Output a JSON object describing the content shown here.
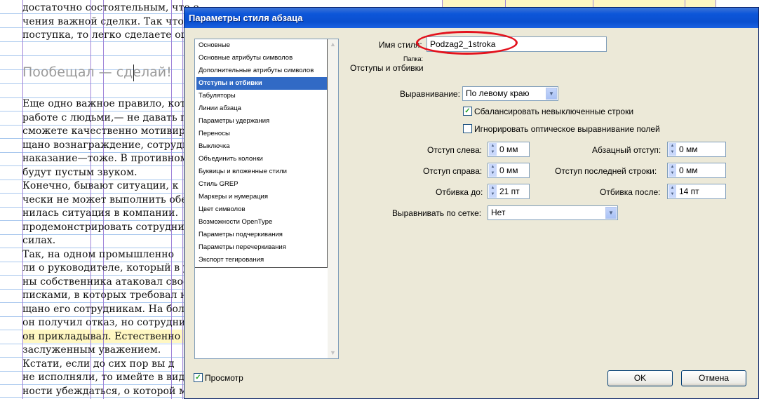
{
  "document": {
    "top_lines": [
      "достаточно состоятельным, что о",
      "чения важной сделки. Так что е",
      "поступка, то легко сделаете ош"
    ],
    "heading": "Пообещал — сделай!",
    "body_lines": [
      "Еще одно важное правило, котор",
      "работе с людьми,— не давать пу",
      "сможете качественно мотивиро",
      "щано вознаграждение, сотрудн",
      "наказание—тоже. В противном",
      "будут пустым звуком.",
      "    Конечно, бывают ситуации, к",
      "чески не может выполнить обе",
      "нилась ситуация в компании.",
      "продемонстрировать сотрудни",
      "силах.",
      "    Так, на одном промышленно",
      "ли о руководителе, который в усл",
      "ны собственника атаковал свое",
      "писками, в которых требовал н",
      "щано его сотрудникам. На бол",
      "он получил отказ, но сотрудник",
      "он прикладывал. Естественно",
      "заслуженным уважением.",
      "    Кстати, если до сих пор вы д",
      "не исполняли, то имейте в вид",
      "ности убеждаться, о которой м"
    ]
  },
  "dialog": {
    "title": "Параметры стиля абзаца",
    "style_name_label": "Имя стиля:",
    "style_name_value": "Podzag2_1stroka",
    "folder_label": "Папка:",
    "section_title": "Отступы и отбивки",
    "categories": [
      "Основные",
      "Основные атрибуты символов",
      "Дополнительные атрибуты символов",
      "Отступы и отбивки",
      "Табуляторы",
      "Линии абзаца",
      "Параметры удержания",
      "Переносы",
      "Выключка",
      "Объединить колонки",
      "Буквицы и вложенные стили",
      "Стиль GREP",
      "Маркеры и нумерация",
      "Цвет символов",
      "Возможности OpenType",
      "Параметры подчеркивания",
      "Параметры перечеркивания",
      "Экспорт тегирования"
    ],
    "selected_category": "Отступы и отбивки",
    "alignment_label": "Выравнивание:",
    "alignment_value": "По левому краю",
    "balance_label": "Сбалансировать невыключенные строки",
    "balance_checked": true,
    "ignore_optical_label": "Игнорировать оптическое выравнивание полей",
    "ignore_optical_checked": false,
    "left_indent_label": "Отступ слева:",
    "left_indent_value": "0 мм",
    "first_line_indent_label": "Абзацный отступ:",
    "first_line_indent_value": "0 мм",
    "right_indent_label": "Отступ справа:",
    "right_indent_value": "0 мм",
    "last_line_indent_label": "Отступ последней строки:",
    "last_line_indent_value": "0 мм",
    "space_before_label": "Отбивка до:",
    "space_before_value": "21 пт",
    "space_after_label": "Отбивка после:",
    "space_after_value": "14 пт",
    "grid_align_label": "Выравнивать по сетке:",
    "grid_align_value": "Нет",
    "preview_label": "Просмотр",
    "preview_checked": true,
    "ok_label": "OK",
    "cancel_label": "Отмена"
  },
  "colors": {
    "titlebar": "#0a4fcf",
    "selection": "#316ac5",
    "highlight_oval": "#e3121d",
    "dialog_bg": "#ece9d8"
  },
  "icons": [
    "scroll-up-icon",
    "scroll-down-icon",
    "dropdown-arrow-icon",
    "spin-up-icon",
    "spin-down-icon",
    "checkmark-icon"
  ]
}
